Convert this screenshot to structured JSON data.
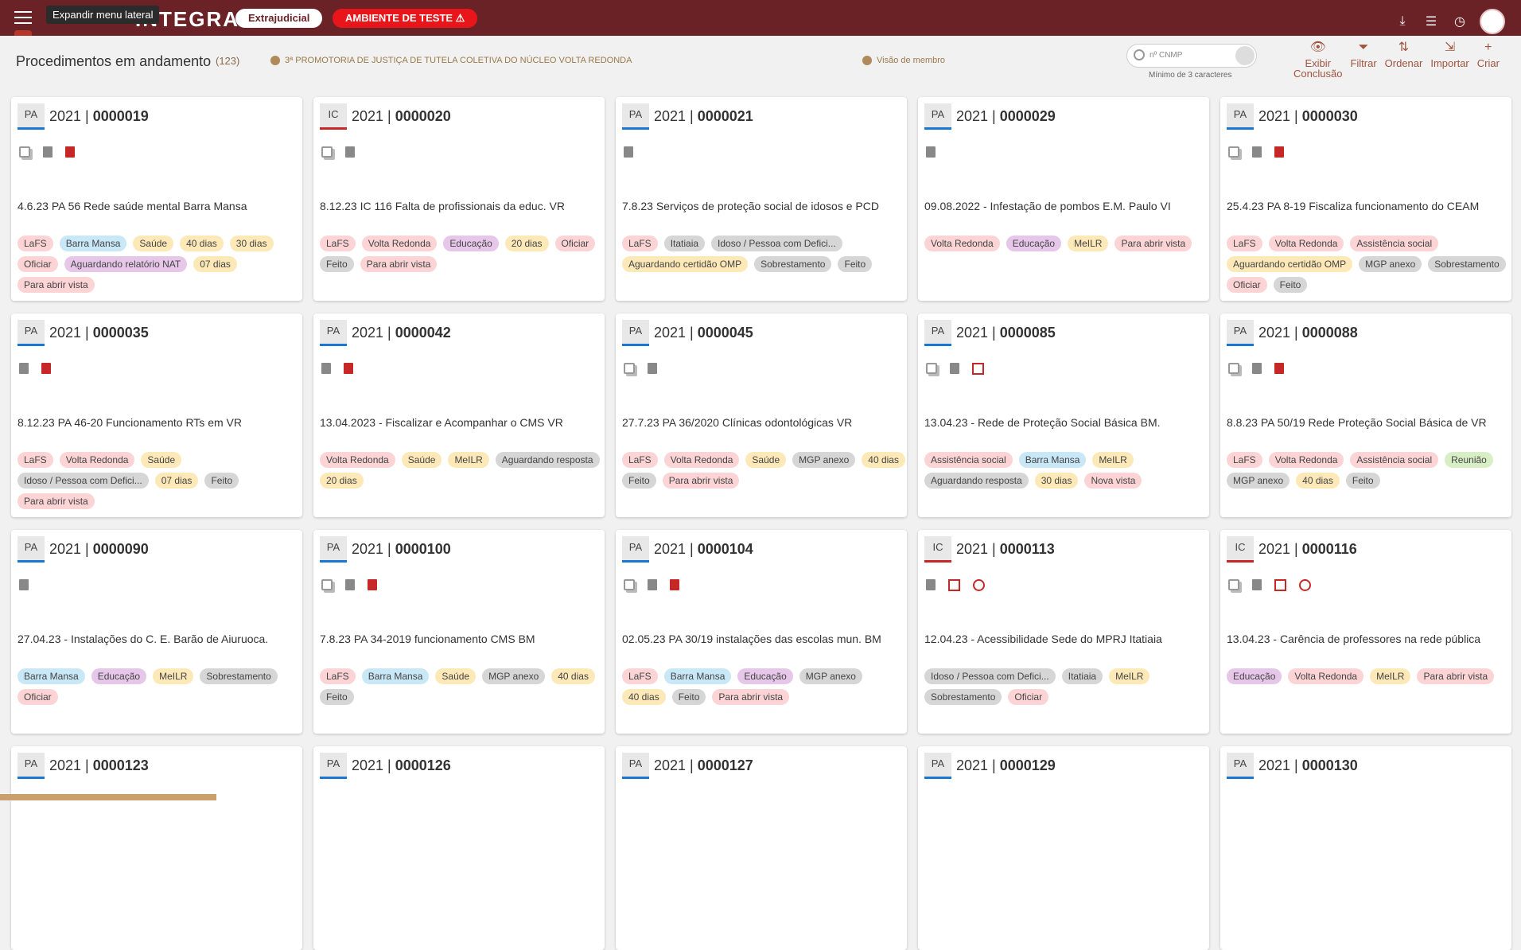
{
  "header": {
    "tooltip": "Expandir menu lateral",
    "brand": "INTEGRA",
    "pill_extra": "Extrajudicial",
    "pill_test": "AMBIENTE DE TESTE ⚠",
    "icons": [
      "download-icon",
      "settings-icon",
      "calendar-icon",
      "avatar"
    ]
  },
  "subheader": {
    "title": "Procedimentos em andamento",
    "count": "(123)",
    "promotoria": "3ª PROMOTORIA DE JUSTIÇA DE TUTELA COLETIVA DO NÚCLEO VOLTA REDONDA",
    "visao": "Visão de membro",
    "search_placeholder": "nº CNMP",
    "search_hint": "Mínimo de 3 caracteres",
    "tools": [
      {
        "label": "Exibir\nConclusão",
        "icon": "eye-icon",
        "glyph": "👁"
      },
      {
        "label": "Filtrar",
        "icon": "filter-icon",
        "glyph": "⏷"
      },
      {
        "label": "Ordenar",
        "icon": "sort-icon",
        "glyph": "⇅"
      },
      {
        "label": "Importar",
        "icon": "import-icon",
        "glyph": "⇲"
      },
      {
        "label": "Criar",
        "icon": "plus-icon",
        "glyph": "+"
      }
    ]
  },
  "tag_colors": {
    "LaFS": "#fcd4d6",
    "Barra Mansa": "#c9e8f7",
    "Saúde": "#fde9b8",
    "40 dias": "#fde9b8",
    "30 dias": "#fde9b8",
    "20 dias": "#fde9b8",
    "07 dias": "#fde9b8",
    "Oficiar": "#fcd4d6",
    "Aguardando relatório NAT": "#e7c7e9",
    "Volta Redonda": "#fcd4d6",
    "Educação": "#e7c7e9",
    "Feito": "#d6d6d6",
    "Para abrir vista": "#fcd4d6",
    "Itatiaia": "#d6d6d6",
    "Idoso / Pessoa com Defici...": "#d6d6d6",
    "Aguardando certidão OMP": "#fde9b8",
    "Sobrestamento": "#d6d6d6",
    "MeILR": "#fde9b8",
    "Assistência social": "#fcd4d6",
    "MGP anexo": "#d6d6d6",
    "Aguardando resposta": "#d6d6d6",
    "Nova vista": "#fcd4d6",
    "Reunião": "#d8efc6"
  },
  "cards": [
    {
      "type": "PA",
      "year": "2021 |",
      "num": "0000019",
      "icons": [
        "copy",
        "doc",
        "pdf"
      ],
      "desc": "4.6.23 PA 56 Rede saúde mental Barra Mansa",
      "tags": [
        "LaFS",
        "Barra Mansa",
        "Saúde",
        "40 dias",
        "30 dias",
        "Oficiar",
        "Aguardando relatório NAT",
        "07 dias",
        "Para abrir vista"
      ]
    },
    {
      "type": "IC",
      "year": "2021 |",
      "num": "0000020",
      "icons": [
        "copy",
        "doc"
      ],
      "desc": "8.12.23 IC 116 Falta de profissionais da educ. VR",
      "tags": [
        "LaFS",
        "Volta Redonda",
        "Educação",
        "20 dias",
        "Oficiar",
        "Feito",
        "Para abrir vista"
      ]
    },
    {
      "type": "PA",
      "year": "2021 |",
      "num": "0000021",
      "icons": [
        "doc"
      ],
      "desc": "7.8.23 Serviços de proteção social de idosos e PCD",
      "tags": [
        "LaFS",
        "Itatiaia",
        "Idoso / Pessoa com Defici...",
        "Aguardando certidão OMP",
        "Sobrestamento",
        "Feito"
      ]
    },
    {
      "type": "PA",
      "year": "2021 |",
      "num": "0000029",
      "icons": [
        "doc"
      ],
      "desc": "09.08.2022 - Infestação de pombos E.M. Paulo VI",
      "tags": [
        "Volta Redonda",
        "Educação",
        "MeILR",
        "Para abrir vista"
      ]
    },
    {
      "type": "PA",
      "year": "2021 |",
      "num": "0000030",
      "icons": [
        "copy",
        "doc",
        "pdf"
      ],
      "desc": "25.4.23 PA 8-19 Fiscaliza funcionamento do CEAM",
      "tags": [
        "LaFS",
        "Volta Redonda",
        "Assistência social",
        "Aguardando certidão OMP",
        "MGP anexo",
        "Sobrestamento",
        "Oficiar",
        "Feito"
      ]
    },
    {
      "type": "PA",
      "year": "2021 |",
      "num": "0000035",
      "icons": [
        "doc",
        "pdf"
      ],
      "desc": "8.12.23 PA 46-20 Funcionamento RTs em VR",
      "tags": [
        "LaFS",
        "Volta Redonda",
        "Saúde",
        "Idoso / Pessoa com Defici...",
        "07 dias",
        "Feito",
        "Para abrir vista"
      ]
    },
    {
      "type": "PA",
      "year": "2021 |",
      "num": "0000042",
      "icons": [
        "doc",
        "pdf"
      ],
      "desc": "13.04.2023 - Fiscalizar e Acompanhar o CMS VR",
      "tags": [
        "Volta Redonda",
        "Saúde",
        "MeILR",
        "Aguardando resposta",
        "20 dias"
      ]
    },
    {
      "type": "PA",
      "year": "2021 |",
      "num": "0000045",
      "icons": [
        "copy",
        "doc"
      ],
      "desc": "27.7.23 PA 36/2020 Clínicas odontológicas VR",
      "tags": [
        "LaFS",
        "Volta Redonda",
        "Saúde",
        "MGP anexo",
        "40 dias",
        "Feito",
        "Para abrir vista"
      ]
    },
    {
      "type": "PA",
      "year": "2021 |",
      "num": "0000085",
      "icons": [
        "copy",
        "doc",
        "list"
      ],
      "desc": "13.04.23 - Rede de Proteção Social Básica BM.",
      "tags": [
        "Assistência social",
        "Barra Mansa",
        "MeILR",
        "Aguardando resposta",
        "30 dias",
        "Nova vista"
      ]
    },
    {
      "type": "PA",
      "year": "2021 |",
      "num": "0000088",
      "icons": [
        "copy",
        "doc",
        "pdf"
      ],
      "desc": "8.8.23 PA 50/19 Rede Proteção Social Básica de VR",
      "tags": [
        "LaFS",
        "Volta Redonda",
        "Assistência social",
        "Reunião",
        "MGP anexo",
        "40 dias",
        "Feito"
      ]
    },
    {
      "type": "PA",
      "year": "2021 |",
      "num": "0000090",
      "icons": [
        "doc"
      ],
      "desc": "27.04.23 - Instalações do C. E. Barão de Aiuruoca.",
      "tags": [
        "Barra Mansa",
        "Educação",
        "MeILR",
        "Sobrestamento",
        "Oficiar"
      ]
    },
    {
      "type": "PA",
      "year": "2021 |",
      "num": "0000100",
      "icons": [
        "copy",
        "doc",
        "pdf"
      ],
      "desc": "7.8.23 PA 34-2019 funcionamento CMS BM",
      "tags": [
        "LaFS",
        "Barra Mansa",
        "Saúde",
        "MGP anexo",
        "40 dias",
        "Feito"
      ]
    },
    {
      "type": "PA",
      "year": "2021 |",
      "num": "0000104",
      "icons": [
        "copy",
        "doc",
        "pdf"
      ],
      "desc": "02.05.23 PA 30/19 instalações das escolas mun. BM",
      "tags": [
        "LaFS",
        "Barra Mansa",
        "Educação",
        "MGP anexo",
        "40 dias",
        "Feito",
        "Para abrir vista"
      ]
    },
    {
      "type": "IC",
      "year": "2021 |",
      "num": "0000113",
      "icons": [
        "doc",
        "list",
        "clock"
      ],
      "desc": "12.04.23 - Acessibilidade Sede do MPRJ Itatiaia",
      "tags": [
        "Idoso / Pessoa com Defici...",
        "Itatiaia",
        "MeILR",
        "Sobrestamento",
        "Oficiar"
      ]
    },
    {
      "type": "IC",
      "year": "2021 |",
      "num": "0000116",
      "icons": [
        "copy",
        "doc",
        "list",
        "clock"
      ],
      "desc": "13.04.23 - Carência de professores na rede pública",
      "tags": [
        "Educação",
        "Volta Redonda",
        "MeILR",
        "Para abrir vista"
      ]
    },
    {
      "type": "PA",
      "year": "2021 |",
      "num": "0000123",
      "icons": [],
      "desc": "",
      "tags": []
    },
    {
      "type": "PA",
      "year": "2021 |",
      "num": "0000126",
      "icons": [],
      "desc": "",
      "tags": []
    },
    {
      "type": "PA",
      "year": "2021 |",
      "num": "0000127",
      "icons": [],
      "desc": "",
      "tags": []
    },
    {
      "type": "PA",
      "year": "2021 |",
      "num": "0000129",
      "icons": [],
      "desc": "",
      "tags": []
    },
    {
      "type": "PA",
      "year": "2021 |",
      "num": "0000130",
      "icons": [],
      "desc": "",
      "tags": []
    }
  ]
}
